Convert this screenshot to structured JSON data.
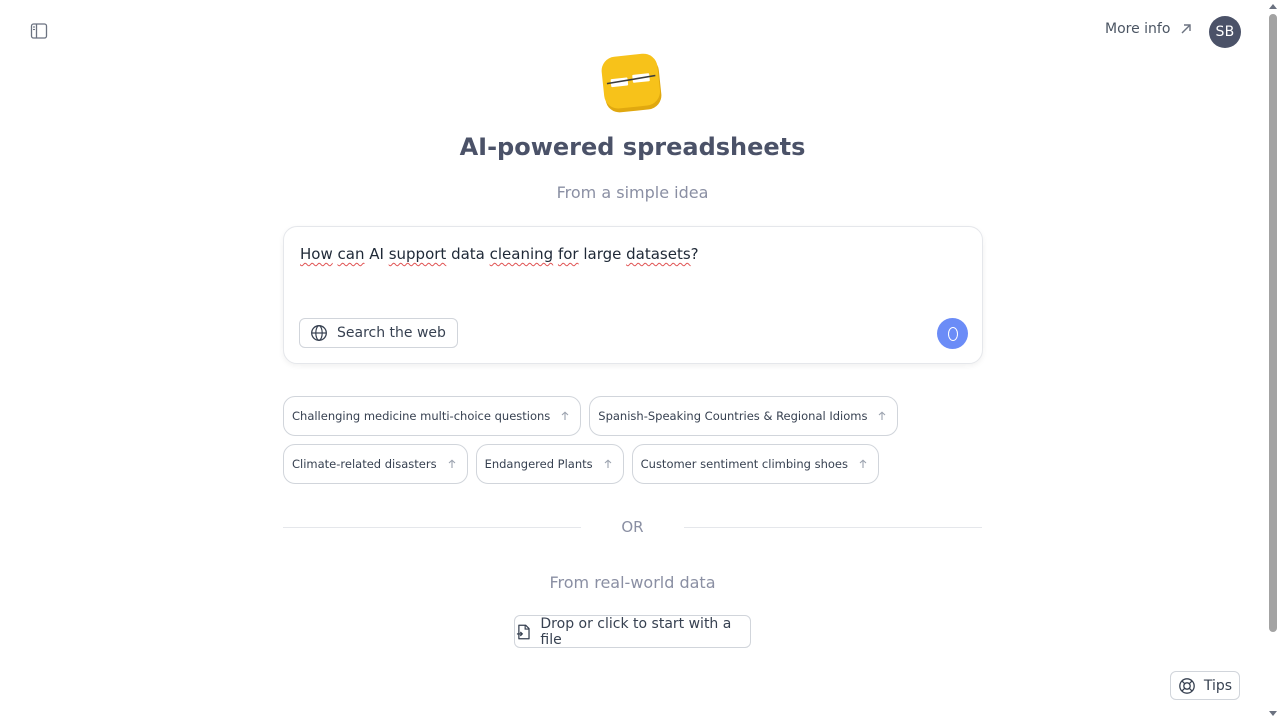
{
  "header": {
    "more_info_label": "More info",
    "avatar_initials": "SB"
  },
  "hero": {
    "title": "AI-powered spreadsheets",
    "subtitle": "From a simple idea"
  },
  "prompt": {
    "text_parts": [
      "How",
      " ",
      "can",
      " AI ",
      "support",
      " data ",
      "cleaning",
      " ",
      "for",
      " large ",
      "datasets",
      "?"
    ],
    "web_search_label": "Search the web",
    "send_button_color": "#6b8cf7"
  },
  "suggestions": {
    "row1": [
      "Challenging medicine multi-choice questions",
      "Spanish-Speaking Countries & Regional Idioms"
    ],
    "row2": [
      "Climate-related disasters",
      "Endangered Plants",
      "Customer sentiment climbing shoes"
    ]
  },
  "divider": {
    "or_label": "OR"
  },
  "file_section": {
    "heading": "From real-world data",
    "button_label": "Drop or click to start with a file"
  },
  "tips": {
    "label": "Tips"
  },
  "colors": {
    "logo_yellow": "#f7c21a",
    "avatar_bg": "#4b5268",
    "title_color": "#4b5268"
  },
  "icons": {
    "sidebar_toggle": "sidebar-toggle-icon",
    "more_info": "arrow-up-right-icon",
    "web": "globe-icon",
    "send": "send-icon",
    "chip": "arrow-up-icon",
    "file": "file-plus-icon",
    "tips": "lifebuoy-icon"
  }
}
